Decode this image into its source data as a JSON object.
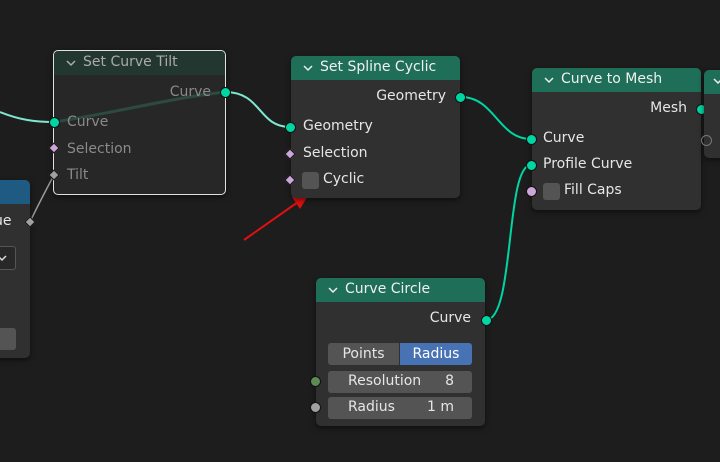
{
  "nodes": {
    "set_curve_tilt": {
      "title": "Set Curve Tilt",
      "outputs": {
        "curve": "Curve"
      },
      "inputs": {
        "curve": "Curve",
        "selection": "Selection",
        "tilt": "Tilt"
      }
    },
    "set_spline_cyclic": {
      "title": "Set Spline Cyclic",
      "outputs": {
        "geometry": "Geometry"
      },
      "inputs": {
        "geometry": "Geometry",
        "selection": "Selection",
        "cyclic": "Cyclic"
      }
    },
    "curve_to_mesh": {
      "title": "Curve to Mesh",
      "outputs": {
        "mesh": "Mesh"
      },
      "inputs": {
        "curve": "Curve",
        "profile_curve": "Profile Curve",
        "fill_caps": "Fill Caps"
      }
    },
    "curve_circle": {
      "title": "Curve Circle",
      "outputs": {
        "curve": "Curve"
      },
      "mode_options": [
        "Points",
        "Radius"
      ],
      "selected_mode": "Radius",
      "resolution": {
        "label": "Resolution",
        "value": "8"
      },
      "radius": {
        "label": "Radius",
        "value": "1 m"
      }
    },
    "left_partial": {
      "label_fragment": "ue"
    }
  },
  "colors": {
    "background": "#1d1d1d",
    "node_body": "#303030",
    "header_geometry": "#1e6e58",
    "header_input": "#1e5a82",
    "socket_geometry": "#00d6a3",
    "socket_boolean": "#cca6d6",
    "socket_float": "#a1a1a1",
    "socket_integer": "#5e8a53",
    "selected_button": "#4772b3",
    "annotation_arrow": "#e01010"
  }
}
